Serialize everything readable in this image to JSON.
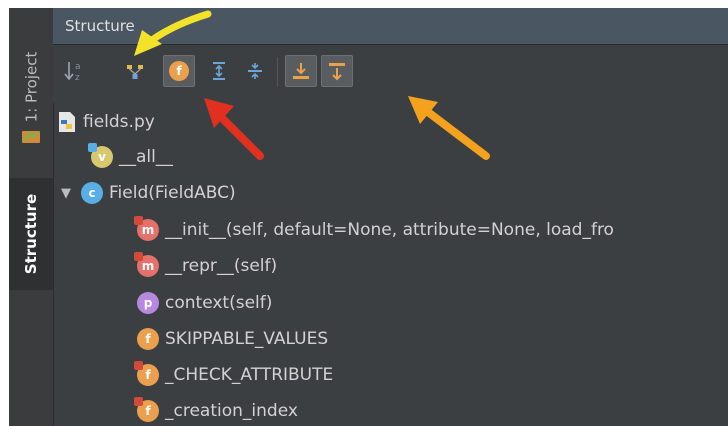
{
  "side_tabs": {
    "project_label": "1: Project",
    "structure_label": "Structure"
  },
  "panel": {
    "title": "Structure"
  },
  "toolbar": {
    "buttons": [
      {
        "name": "sort-alphabetically-button",
        "icon": "sort-az-icon"
      },
      {
        "name": "show-inherited-button",
        "icon": "hierarchy-icon"
      },
      {
        "name": "show-fields-button",
        "icon": "field-f-icon",
        "active": true
      },
      {
        "name": "expand-all-button",
        "icon": "expand-all-icon"
      },
      {
        "name": "collapse-all-button",
        "icon": "collapse-all-icon"
      },
      {
        "name": "autoscroll-to-source-button",
        "icon": "scroll-to-source-icon",
        "active": true
      },
      {
        "name": "autoscroll-from-source-button",
        "icon": "scroll-from-source-icon",
        "active": true
      }
    ]
  },
  "tree": {
    "file": "fields.py",
    "all_var": "__all__",
    "class_name": "Field(FieldABC)",
    "init": "__init__(self, default=None, attribute=None, load_fro",
    "repr": "__repr__(self)",
    "context": "context(self)",
    "skippable": "SKIPPABLE_VALUES",
    "check_attr": "_CHECK_ATTRIBUTE",
    "creation_index": "_creation_index"
  },
  "icon_letters": {
    "var": "v",
    "class": "c",
    "method": "m",
    "property": "p",
    "field": "f"
  },
  "colors": {
    "method": "#e6716c",
    "field": "#eaa04f",
    "class": "#5aaee6",
    "property": "#b788e0",
    "var": "#d7c86d",
    "annotation_yellow": "#f2e22a",
    "annotation_red": "#e0301f",
    "annotation_orange": "#f4a21e"
  }
}
